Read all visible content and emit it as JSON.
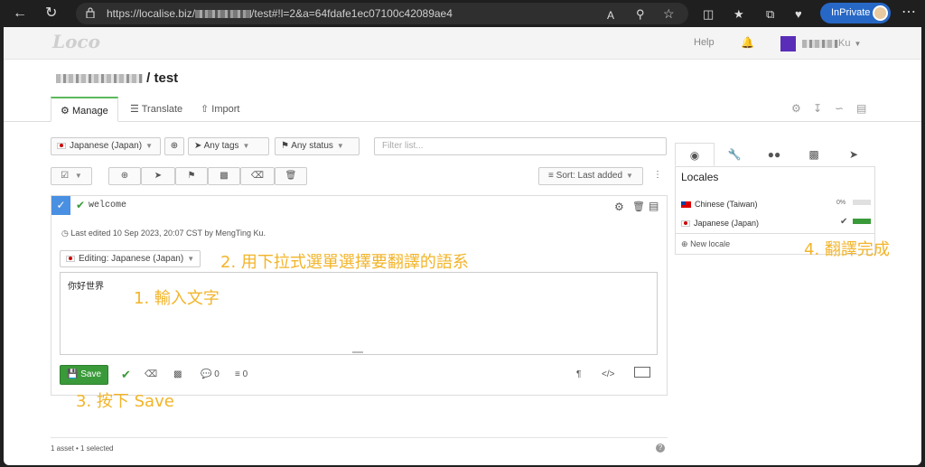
{
  "browser": {
    "url": "https://localise.biz/",
    "url_tail": "/test#!l=2&a=64fdafe1ec07100c42089ae4",
    "inprivate_label": "InPrivate"
  },
  "app": {
    "logo": "Loco",
    "help": "Help",
    "user_suffix": "Ku",
    "project": "/ test"
  },
  "tabs": [
    {
      "label": "Manage"
    },
    {
      "label": "Translate"
    },
    {
      "label": "Import"
    }
  ],
  "filters": {
    "locale": "Japanese (Japan)",
    "tags": "Any tags",
    "status": "Any status",
    "search_placeholder": "Filter list..."
  },
  "sort_label": "Sort: Last added",
  "asset": {
    "id": "welcome",
    "meta": "Last edited 10 Sep 2023, 20:07 CST by MengTing Ku.",
    "editing": "Editing: Japanese (Japan)",
    "text": "你好世界",
    "save": "Save",
    "comments": "0",
    "layers": "0",
    "pilcrow": "¶",
    "code": "</>"
  },
  "locales": {
    "title": "Locales",
    "items": [
      {
        "name": "Chinese (Taiwan)",
        "progress_label": "0%",
        "progress": 0,
        "flag": "tw"
      },
      {
        "name": "Japanese (Japan)",
        "progress_label": "",
        "progress": 100,
        "flag": "jp"
      }
    ],
    "new_locale": "New locale"
  },
  "footer": "1 asset • 1 selected",
  "annotations": {
    "a1": "1. 輸入文字",
    "a2": "2. 用下拉式選單選擇要翻譯的語系",
    "a3": "3. 按下 Save",
    "a4": "4. 翻譯完成"
  },
  "colors": {
    "accent_green": "#3a9a3a",
    "annotation": "#f2b42a",
    "browser_accent": "#2768c6"
  }
}
